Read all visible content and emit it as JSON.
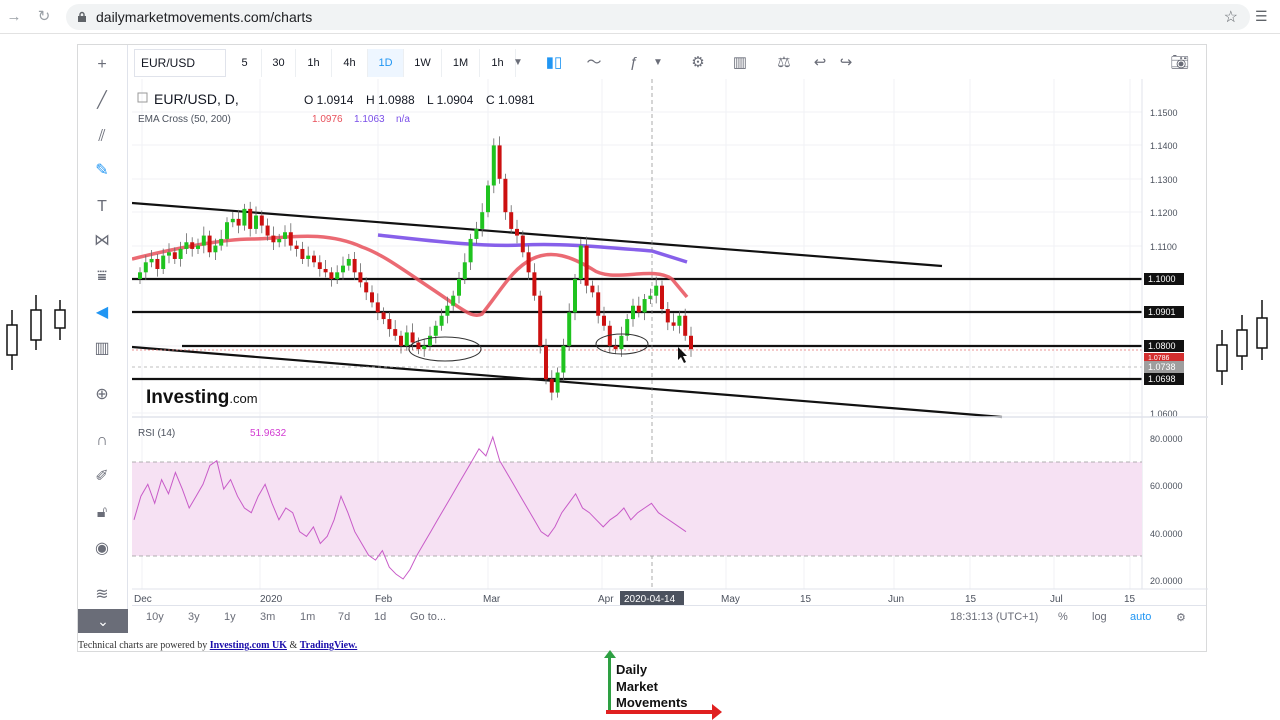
{
  "browser": {
    "url": "dailymarketmovements.com/charts"
  },
  "toolbar": {
    "symbol": "EUR/USD",
    "timeframes": [
      "5",
      "30",
      "1h",
      "4h",
      "1D",
      "1W",
      "1M",
      "1h"
    ],
    "active_timeframe": "1D"
  },
  "legend": {
    "pair": "EUR/USD, D,",
    "open": "O 1.0914",
    "high": "H 1.0988",
    "low": "L 1.0904",
    "close": "C 1.0981",
    "ema_label": "EMA Cross (50, 200)",
    "ema_fast": "1.0976",
    "ema_slow": "1.1063",
    "ema_na": "n/a",
    "rsi_label": "RSI (14)",
    "rsi_value": "51.9632"
  },
  "watermark": {
    "brand": "Investing",
    "suffix": ".com"
  },
  "chart_data": {
    "type": "candlestick",
    "price_axis": [
      "1.1500",
      "1.1400",
      "1.1300",
      "1.1200",
      "1.1100",
      "1.0600"
    ],
    "price_range": [
      1.055,
      1.165
    ],
    "horizontal_levels": [
      "1.1000",
      "1.0901",
      "1.0800",
      "1.0738",
      "1.0698"
    ],
    "highlighted_level": "1.0786",
    "time_axis": [
      "Dec",
      "2020",
      "Feb",
      "Mar",
      "Apr",
      "May",
      "15",
      "Jun",
      "15",
      "Jul",
      "15"
    ],
    "crosshair_date": "2020-04-14",
    "rsi_axis": [
      "80.0000",
      "60.0000",
      "40.0000",
      "20.0000"
    ],
    "rsi_band": [
      30,
      70
    ],
    "colors": {
      "up": "#1fc31f",
      "down": "#cc1010",
      "ema_fast": "#e8505b",
      "ema_slow": "#7a4fe8",
      "rsi": "#c85bc8",
      "rsi_band_fill": "#f6e1f3"
    }
  },
  "bottom_bar": {
    "ranges": [
      "10y",
      "3y",
      "1y",
      "3m",
      "1m",
      "7d",
      "1d"
    ],
    "goto": "Go to...",
    "time": "18:31:13 (UTC+1)",
    "percent": "%",
    "log": "log",
    "auto": "auto"
  },
  "credit": {
    "text": "Technical charts are powered by",
    "link1": "Investing.com UK",
    "amp": "&",
    "link2": "TradingView."
  },
  "logo": {
    "line1": "Daily",
    "line2": "Market",
    "line3": "Movements"
  }
}
